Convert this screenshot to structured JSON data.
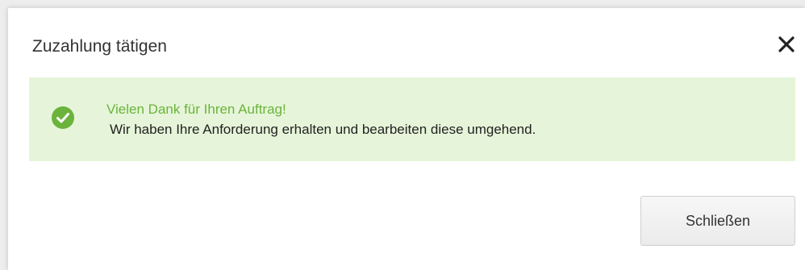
{
  "dialog": {
    "title": "Zuzahlung tätigen",
    "close_icon": "close-icon"
  },
  "alert": {
    "icon": "check-circle-icon",
    "heading": "Vielen Dank für Ihren Auftrag!",
    "message": "Wir haben Ihre Anforderung erhalten und bearbeiten diese umgehend.",
    "background_color": "#e6f5d9",
    "accent_color": "#6bb33c"
  },
  "footer": {
    "close_label": "Schließen"
  }
}
